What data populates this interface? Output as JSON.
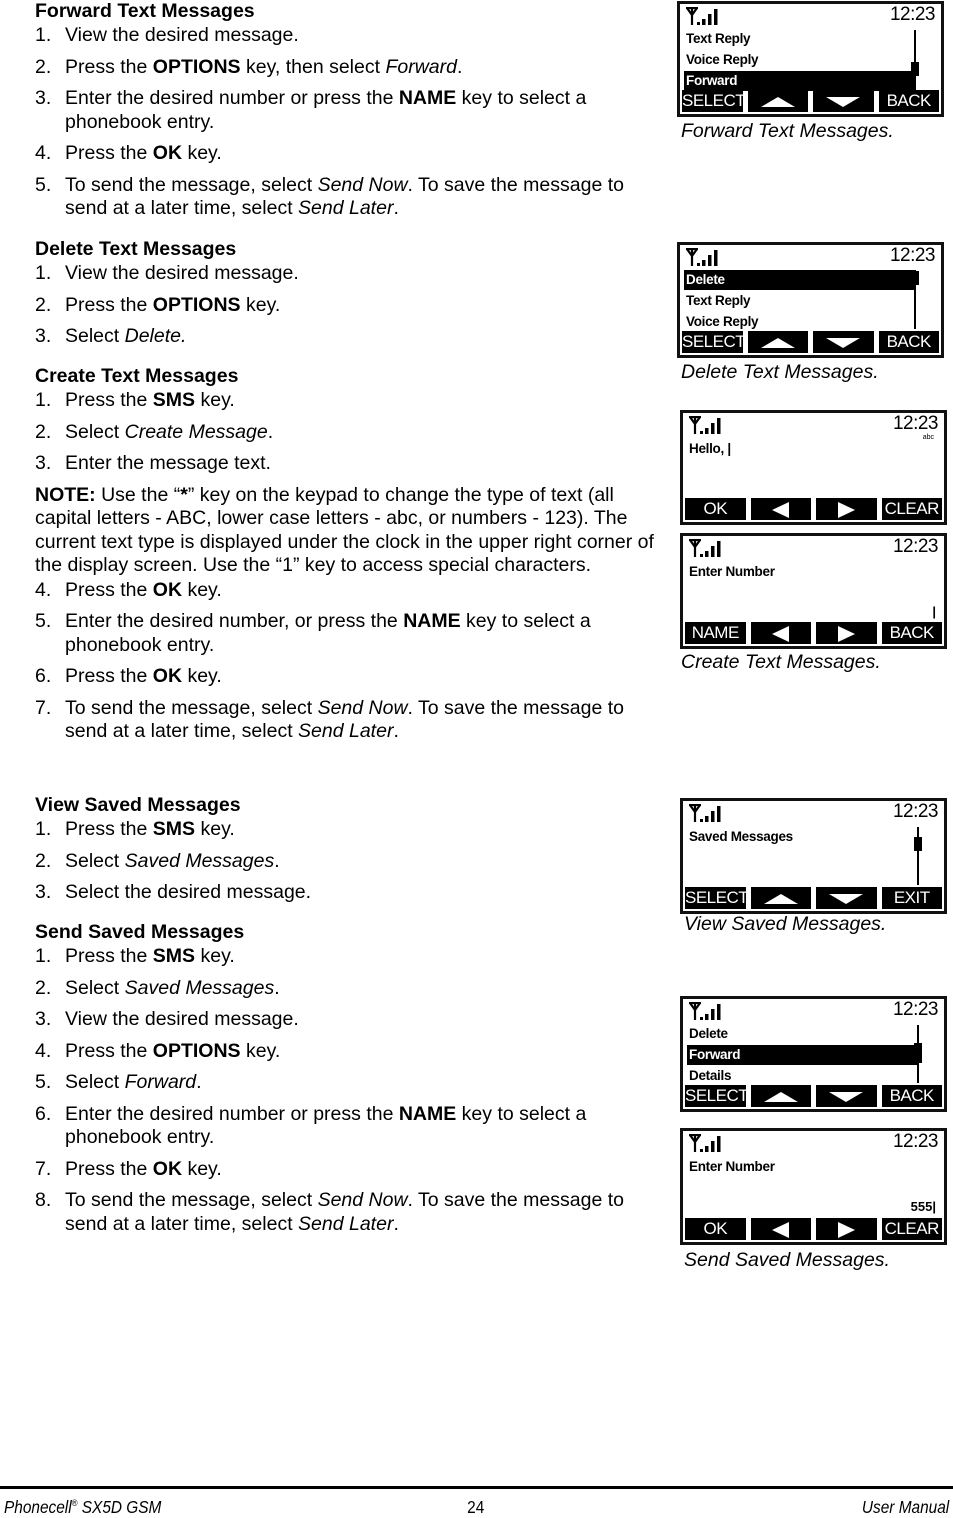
{
  "sections": [
    {
      "title": "Forward Text Messages",
      "steps": [
        {
          "n": "1.",
          "parts": [
            [
              "t",
              "View the desired message."
            ]
          ]
        },
        {
          "n": "2.",
          "parts": [
            [
              "t",
              "Press the "
            ],
            [
              "b",
              "OPTIONS"
            ],
            [
              "t",
              " key, then select "
            ],
            [
              "i",
              "Forward"
            ],
            [
              "t",
              "."
            ]
          ]
        },
        {
          "n": "3.",
          "parts": [
            [
              "t",
              "Enter the desired number or press the "
            ],
            [
              "b",
              "NAME"
            ],
            [
              "t",
              " key to select a phonebook entry."
            ]
          ]
        },
        {
          "n": "4.",
          "parts": [
            [
              "t",
              "Press the "
            ],
            [
              "b",
              "OK"
            ],
            [
              "t",
              " key."
            ]
          ]
        },
        {
          "n": "5.",
          "parts": [
            [
              "t",
              "To send the message, select "
            ],
            [
              "i",
              "Send Now"
            ],
            [
              "t",
              ". To save the message to send at a later time, select "
            ],
            [
              "i",
              "Send Later"
            ],
            [
              "t",
              "."
            ]
          ]
        }
      ]
    },
    {
      "title": "Delete Text Messages",
      "steps": [
        {
          "n": "1.",
          "parts": [
            [
              "t",
              "View the desired message."
            ]
          ]
        },
        {
          "n": "2.",
          "parts": [
            [
              "t",
              "Press the "
            ],
            [
              "b",
              "OPTIONS"
            ],
            [
              "t",
              " key."
            ]
          ]
        },
        {
          "n": "3.",
          "parts": [
            [
              "t",
              "Select "
            ],
            [
              "i",
              "Delete."
            ]
          ]
        }
      ]
    },
    {
      "title": "Create Text Messages",
      "steps": [
        {
          "n": "1.",
          "parts": [
            [
              "t",
              "Press the "
            ],
            [
              "b",
              "SMS"
            ],
            [
              "t",
              " key."
            ]
          ]
        },
        {
          "n": "2.",
          "parts": [
            [
              "t",
              "Select "
            ],
            [
              "i",
              "Create Message"
            ],
            [
              "t",
              "."
            ]
          ]
        },
        {
          "n": "3.",
          "parts": [
            [
              "t",
              "Enter the message text."
            ]
          ]
        }
      ],
      "note": [
        [
          "b",
          "NOTE:"
        ],
        [
          "t",
          " Use the “"
        ],
        [
          "b",
          "*"
        ],
        [
          "t",
          "” key on the keypad to change the type of text (all capital letters - ABC, lower case letters - abc, or numbers - 123). The current text type is displayed under the clock in the upper right corner of the display screen. Use the “1” key to access special characters."
        ]
      ],
      "steps_after": [
        {
          "n": "4.",
          "parts": [
            [
              "t",
              "Press the "
            ],
            [
              "b",
              "OK"
            ],
            [
              "t",
              " key."
            ]
          ]
        },
        {
          "n": "5.",
          "parts": [
            [
              "t",
              "Enter the desired number, or press the "
            ],
            [
              "b",
              "NAME"
            ],
            [
              "t",
              " key to select a phonebook entry."
            ]
          ]
        },
        {
          "n": "6.",
          "parts": [
            [
              "t",
              "Press the "
            ],
            [
              "b",
              "OK"
            ],
            [
              "t",
              " key."
            ]
          ]
        },
        {
          "n": "7.",
          "parts": [
            [
              "t",
              "To send the message, select "
            ],
            [
              "i",
              "Send Now"
            ],
            [
              "t",
              ". To save the message to send at a later time, select "
            ],
            [
              "i",
              "Send Later"
            ],
            [
              "t",
              "."
            ]
          ]
        }
      ]
    },
    {
      "title": "View Saved Messages",
      "steps": [
        {
          "n": "1.",
          "parts": [
            [
              "t",
              "Press the "
            ],
            [
              "b",
              "SMS"
            ],
            [
              "t",
              " key."
            ]
          ]
        },
        {
          "n": "2.",
          "parts": [
            [
              "t",
              "Select "
            ],
            [
              "i",
              "Saved Messages"
            ],
            [
              "t",
              "."
            ]
          ]
        },
        {
          "n": "3.",
          "parts": [
            [
              "t",
              "Select the desired message."
            ]
          ]
        }
      ]
    },
    {
      "title": "Send Saved Messages",
      "steps": [
        {
          "n": "1.",
          "parts": [
            [
              "t",
              "Press the "
            ],
            [
              "b",
              "SMS"
            ],
            [
              "t",
              " key."
            ]
          ]
        },
        {
          "n": "2.",
          "parts": [
            [
              "t",
              "Select "
            ],
            [
              "i",
              "Saved Messages"
            ],
            [
              "t",
              "."
            ]
          ]
        },
        {
          "n": "3.",
          "parts": [
            [
              "t",
              "View the desired message."
            ]
          ]
        },
        {
          "n": "4.",
          "parts": [
            [
              "t",
              "Press the "
            ],
            [
              "b",
              "OPTIONS"
            ],
            [
              "t",
              " key."
            ]
          ]
        },
        {
          "n": "5.",
          "parts": [
            [
              "t",
              "Select "
            ],
            [
              "i",
              "Forward"
            ],
            [
              "t",
              "."
            ]
          ]
        },
        {
          "n": "6.",
          "parts": [
            [
              "t",
              "Enter the desired number or press the "
            ],
            [
              "b",
              "NAME"
            ],
            [
              "t",
              " key to select a phonebook entry."
            ]
          ]
        },
        {
          "n": "7.",
          "parts": [
            [
              "t",
              "Press the "
            ],
            [
              "b",
              "OK"
            ],
            [
              "t",
              " key."
            ]
          ]
        },
        {
          "n": "8.",
          "parts": [
            [
              "t",
              "To send the message, select "
            ],
            [
              "i",
              "Send Now"
            ],
            [
              "t",
              ". To save the message to send at a later time, select "
            ],
            [
              "i",
              "Send Later"
            ],
            [
              "t",
              "."
            ]
          ]
        }
      ]
    }
  ],
  "screens": {
    "forward": {
      "clock": "12:23",
      "rows": [
        "Text Reply",
        "Voice Reply",
        "Forward"
      ],
      "selected": "Forward",
      "softkeys": [
        "SELECT",
        "up-arrow",
        "down-arrow",
        "BACK"
      ]
    },
    "delete": {
      "clock": "12:23",
      "rows": [
        "Delete",
        "Text Reply",
        "Voice Reply"
      ],
      "selected": "Delete",
      "softkeys": [
        "SELECT",
        "up-arrow",
        "down-arrow",
        "BACK"
      ]
    },
    "create1": {
      "clock": "12:23",
      "mode": "abc",
      "text": "Hello, |",
      "softkeys": [
        "OK",
        "left-arrow",
        "right-arrow",
        "CLEAR"
      ]
    },
    "create2": {
      "clock": "12:23",
      "text": "Enter Number",
      "entry": "|",
      "softkeys": [
        "NAME",
        "left-arrow",
        "right-arrow",
        "BACK"
      ]
    },
    "view": {
      "clock": "12:23",
      "rows": [
        "Saved Messages"
      ],
      "softkeys": [
        "SELECT",
        "up-arrow",
        "down-arrow",
        "EXIT"
      ]
    },
    "send1": {
      "clock": "12:23",
      "rows": [
        "Delete",
        "Forward",
        "Details"
      ],
      "selected": "Forward",
      "softkeys": [
        "SELECT",
        "up-arrow",
        "down-arrow",
        "BACK"
      ]
    },
    "send2": {
      "clock": "12:23",
      "text": "Enter Number",
      "entry": "555|",
      "softkeys": [
        "OK",
        "left-arrow",
        "right-arrow",
        "CLEAR"
      ]
    }
  },
  "captions": {
    "forward": "Forward Text Messages.",
    "delete": "Delete Text Messages.",
    "create": "Create Text Messages.",
    "view": "View Saved Messages.",
    "send": "Send Saved Messages."
  },
  "footer": {
    "product": "Phonecell",
    "reg": "®",
    "model": " SX5D GSM",
    "page": "24",
    "doc": "User Manual"
  }
}
